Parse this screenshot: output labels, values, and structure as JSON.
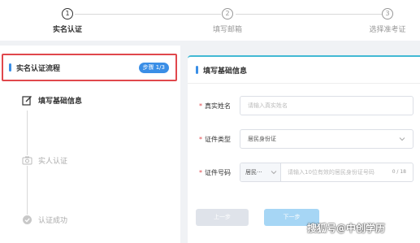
{
  "stepper": {
    "steps": [
      {
        "number": "1",
        "label": "实名认证",
        "active": true
      },
      {
        "number": "2",
        "label": "填写邮箱",
        "active": false
      },
      {
        "number": "3",
        "label": "选择准考证",
        "active": false
      }
    ]
  },
  "flow": {
    "title": "实名认证流程",
    "badge": "步骤 1/3",
    "items": [
      {
        "label": "填写基础信息",
        "icon": "edit-icon",
        "state": "active"
      },
      {
        "label": "实人认证",
        "icon": "camera-icon",
        "state": "pending"
      },
      {
        "label": "认证成功",
        "icon": "check-circle-icon",
        "state": "pending"
      }
    ]
  },
  "form": {
    "title": "填写基础信息",
    "name": {
      "label": "真实姓名",
      "placeholder": "请输入真实姓名"
    },
    "id_type": {
      "label": "证件类型",
      "value": "居民身份证"
    },
    "id_number": {
      "label": "证件号码",
      "type_value": "居民···",
      "placeholder": "请输入10位有效的居民身份证号码",
      "counter": "0 / 18"
    },
    "prev_label": "上一步",
    "next_label": "下一步"
  },
  "watermark": "搜狐号@中创学历",
  "colors": {
    "accent": "#3a8ee6",
    "highlight_border": "#e0474c",
    "panel_top": "#42b9d4"
  }
}
